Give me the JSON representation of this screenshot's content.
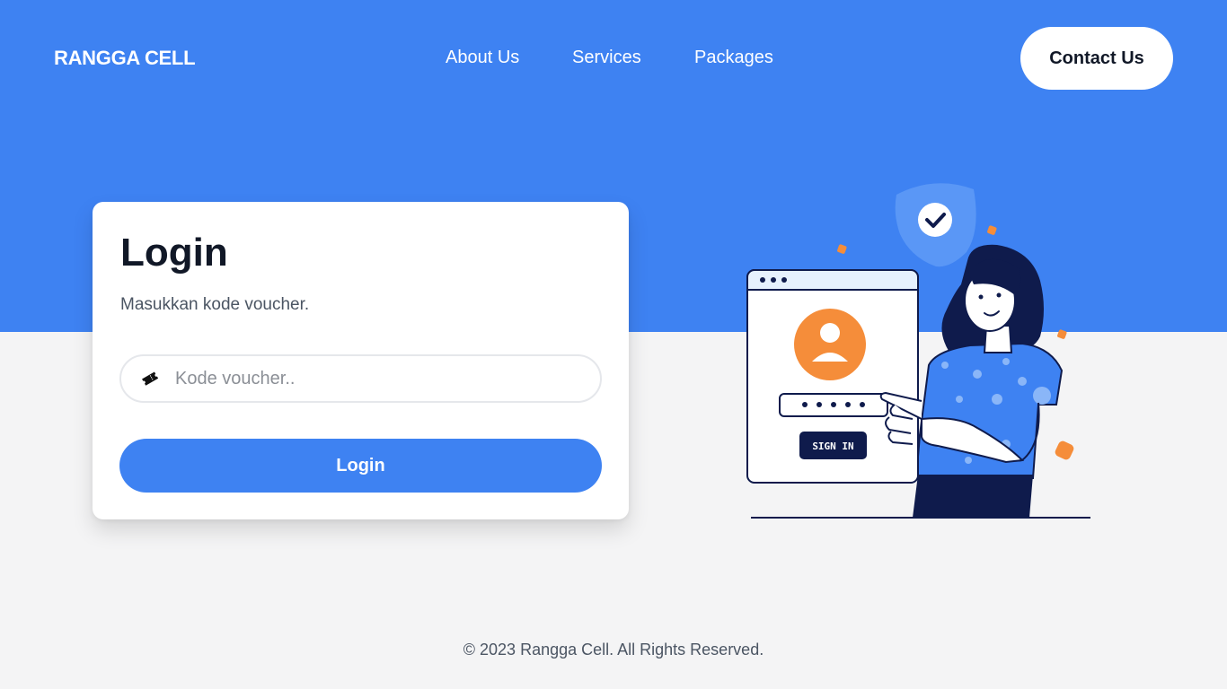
{
  "header": {
    "brand": "RANGGA CELL",
    "nav": [
      {
        "label": "About Us"
      },
      {
        "label": "Services"
      },
      {
        "label": "Packages"
      }
    ],
    "contact_label": "Contact Us"
  },
  "login": {
    "title": "Login",
    "subtitle": "Masukkan kode voucher.",
    "voucher_placeholder": "Kode voucher..",
    "voucher_value": "",
    "input_icon": "ticket-icon",
    "submit_label": "Login"
  },
  "illustration": {
    "sign_in_label": "SIGN IN"
  },
  "footer": {
    "copyright": "© 2023 Rangga Cell. All Rights Reserved."
  },
  "colors": {
    "primary": "#3e82f2",
    "accent_orange": "#f58d3a",
    "navy": "#0f1b4c",
    "background": "#f4f4f5"
  }
}
